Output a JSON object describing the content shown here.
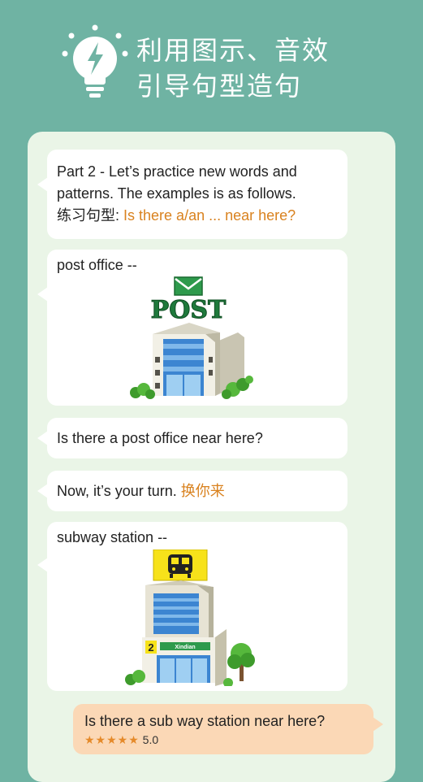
{
  "header": {
    "icon": "lightbulb-lightning-icon",
    "line1": "利用图示、音效",
    "line2": "引导句型造句"
  },
  "chat": {
    "intro": {
      "text": "Part 2 - Let’s practice new words and patterns. The examples is as follows.",
      "pattern_label": "练习句型:",
      "pattern": "Is there a/an ... near here?"
    },
    "word1": {
      "label": "post office --",
      "sign": "POST",
      "icon": "post-office-building-illustration"
    },
    "example": {
      "text": "Is there a post office near here?"
    },
    "prompt": {
      "text": "Now, it’s your turn.",
      "highlight": "换你来"
    },
    "word2": {
      "label": "subway station --",
      "icon": "subway-station-building-illustration",
      "sign_number": "2",
      "sign_name": "Xindian"
    },
    "answer": {
      "text": "Is there a sub way station near here?",
      "stars": "★★★★★",
      "score": "5.0"
    }
  },
  "colors": {
    "background": "#6fb3a3",
    "panel": "#eaf5e7",
    "highlight": "#d9821f",
    "user_bubble": "#fbd8b6"
  }
}
